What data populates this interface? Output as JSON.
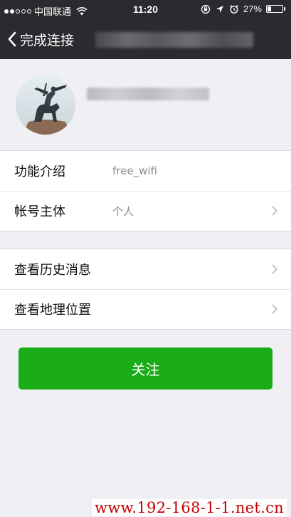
{
  "status_bar": {
    "carrier": "中国联通",
    "time": "11:20",
    "battery": "27%",
    "battery_level": 0.27
  },
  "nav": {
    "back_label": "完成连接"
  },
  "rows_group1": [
    {
      "label": "功能介绍",
      "value": "free_wifi"
    },
    {
      "label": "帐号主体",
      "value": "个人"
    }
  ],
  "rows_group2": [
    {
      "label": "查看历史消息"
    },
    {
      "label": "查看地理位置"
    }
  ],
  "follow_button": "关注",
  "watermark": "www.192-168-1-1.net.cn"
}
